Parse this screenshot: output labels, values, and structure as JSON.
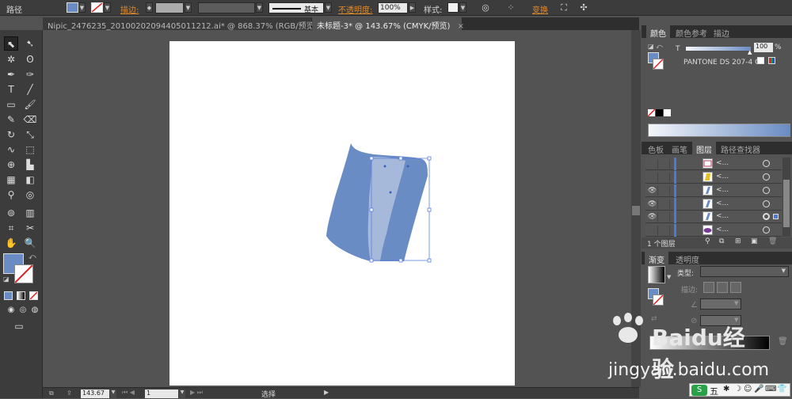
{
  "controlbar": {
    "path_label": "路径",
    "stroke_label": "描边:",
    "stroke_profile": "基本",
    "opacity_label": "不透明度:",
    "opacity_value": "100%",
    "style_label": "样式:",
    "transform_label": "变换",
    "fill_color": "#6a8cc4"
  },
  "tabs": [
    {
      "label": "Nipic_2476235_20100202094405011212.ai* @ 868.37% (RGB/预览)",
      "active": false
    },
    {
      "label": "未标题-3* @ 143.67% (CMYK/预览)",
      "active": true
    }
  ],
  "tools": {
    "selection": "selection-icon",
    "direct_selection": "direct-selection-icon",
    "fill_color": "#6a8cc4"
  },
  "color_panel": {
    "tabs": [
      "颜色",
      "颜色参考",
      "描边"
    ],
    "t_label": "T",
    "tint_value": "100",
    "swatch_name": "PANTONE DS 207-4 C",
    "accent": "#6a8cc4"
  },
  "layers_panel": {
    "tabs": [
      "色板",
      "画笔",
      "图层",
      "路径查找器"
    ],
    "rows": [
      {
        "name": "<...",
        "visible": false
      },
      {
        "name": "<...",
        "visible": false
      },
      {
        "name": "<...",
        "visible": true
      },
      {
        "name": "<...",
        "visible": true
      },
      {
        "name": "<...",
        "visible": true
      },
      {
        "name": "<...",
        "visible": false
      }
    ],
    "count_label": "1 个图层"
  },
  "gradient_panel": {
    "tabs": [
      "渐变",
      "透明度"
    ],
    "type_label": "类型:",
    "stroke_label": "描边:",
    "position_label": "位置"
  },
  "statusbar": {
    "zoom": "143.67",
    "page": "1",
    "mode": "选择"
  },
  "watermark": {
    "brand": "Baidu经验",
    "url": "jingyan.baidu.com"
  },
  "ime": {
    "label": "五"
  }
}
